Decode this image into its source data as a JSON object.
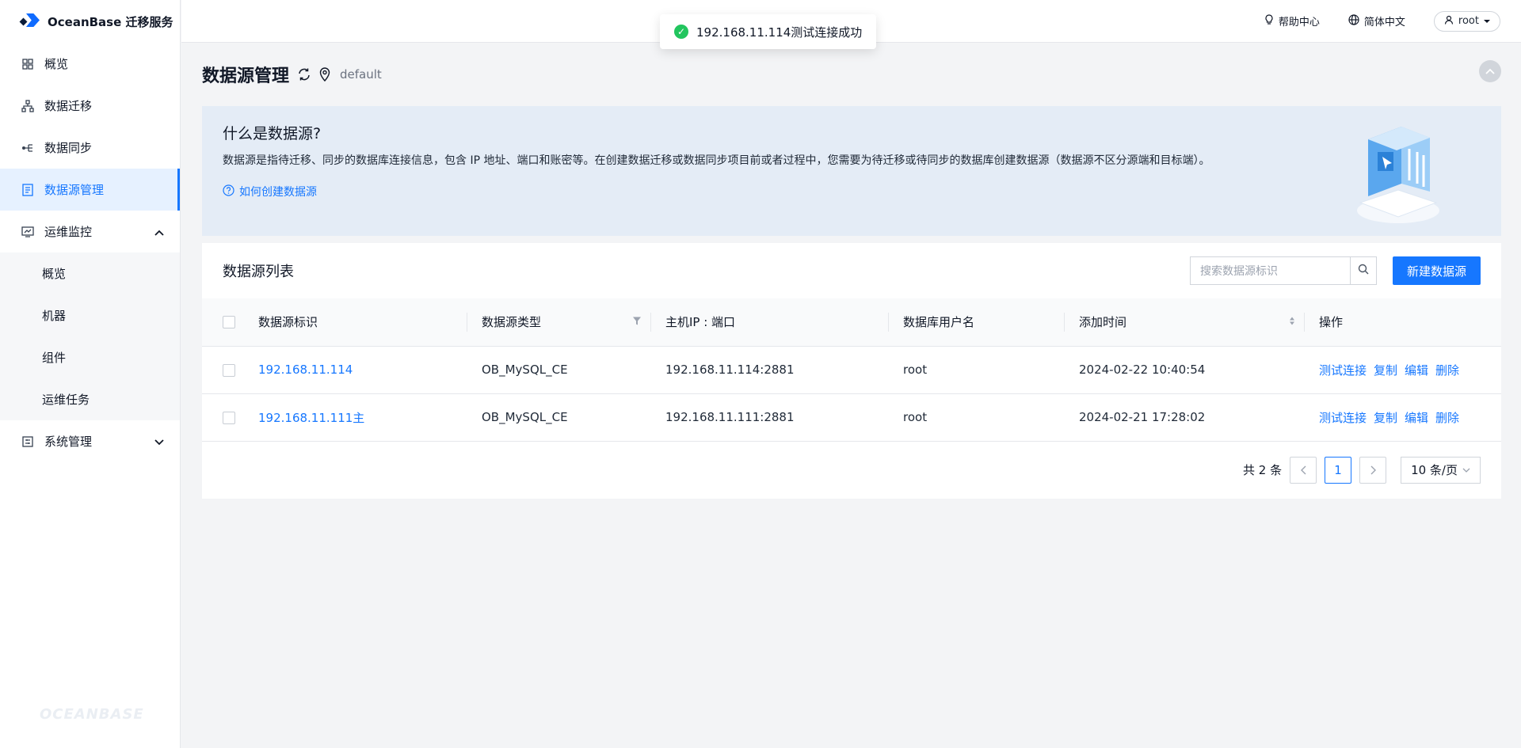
{
  "app": {
    "title": "OceanBase 迁移服务",
    "watermark": "OCEANBASE"
  },
  "sidebar": {
    "items": [
      {
        "label": "概览",
        "icon": "grid-icon"
      },
      {
        "label": "数据迁移",
        "icon": "sitemap-icon"
      },
      {
        "label": "数据同步",
        "icon": "sync-branch-icon"
      },
      {
        "label": "数据源管理",
        "icon": "database-doc-icon",
        "active": true
      },
      {
        "label": "运维监控",
        "icon": "monitor-icon",
        "expanded": true
      },
      {
        "label": "系统管理",
        "icon": "settings-panel-icon",
        "expanded": false
      }
    ],
    "ops_sub": [
      "概览",
      "机器",
      "组件",
      "运维任务"
    ]
  },
  "topbar": {
    "help": "帮助中心",
    "lang": "简体中文",
    "user": "root"
  },
  "toast": {
    "message": "192.168.11.114测试连接成功"
  },
  "page": {
    "title": "数据源管理",
    "namespace": "default"
  },
  "info": {
    "title": "什么是数据源?",
    "desc": "数据源是指待迁移、同步的数据库连接信息，包含 IP 地址、端口和账密等。在创建数据迁移或数据同步项目前或者过程中，您需要为待迁移或待同步的数据库创建数据源（数据源不区分源端和目标端）。",
    "howto": "如何创建数据源"
  },
  "list": {
    "title": "数据源列表",
    "search_placeholder": "搜索数据源标识",
    "create_label": "新建数据源",
    "columns": [
      "数据源标识",
      "数据源类型",
      "主机IP : 端口",
      "数据库用户名",
      "添加时间",
      "操作"
    ],
    "rows": [
      {
        "id": "192.168.11.114",
        "type": "OB_MySQL_CE",
        "host": "192.168.11.114:2881",
        "user": "root",
        "time": "2024-02-22 10:40:54"
      },
      {
        "id": "192.168.11.111主",
        "type": "OB_MySQL_CE",
        "host": "192.168.11.111:2881",
        "user": "root",
        "time": "2024-02-21 17:28:02"
      }
    ],
    "actions": [
      "测试连接",
      "复制",
      "编辑",
      "删除"
    ]
  },
  "pagination": {
    "total": "共 2 条",
    "current": "1",
    "size": "10 条/页"
  },
  "colors": {
    "primary": "#1677ff",
    "success": "#22c55e",
    "info_bg": "#e4ecf6"
  }
}
